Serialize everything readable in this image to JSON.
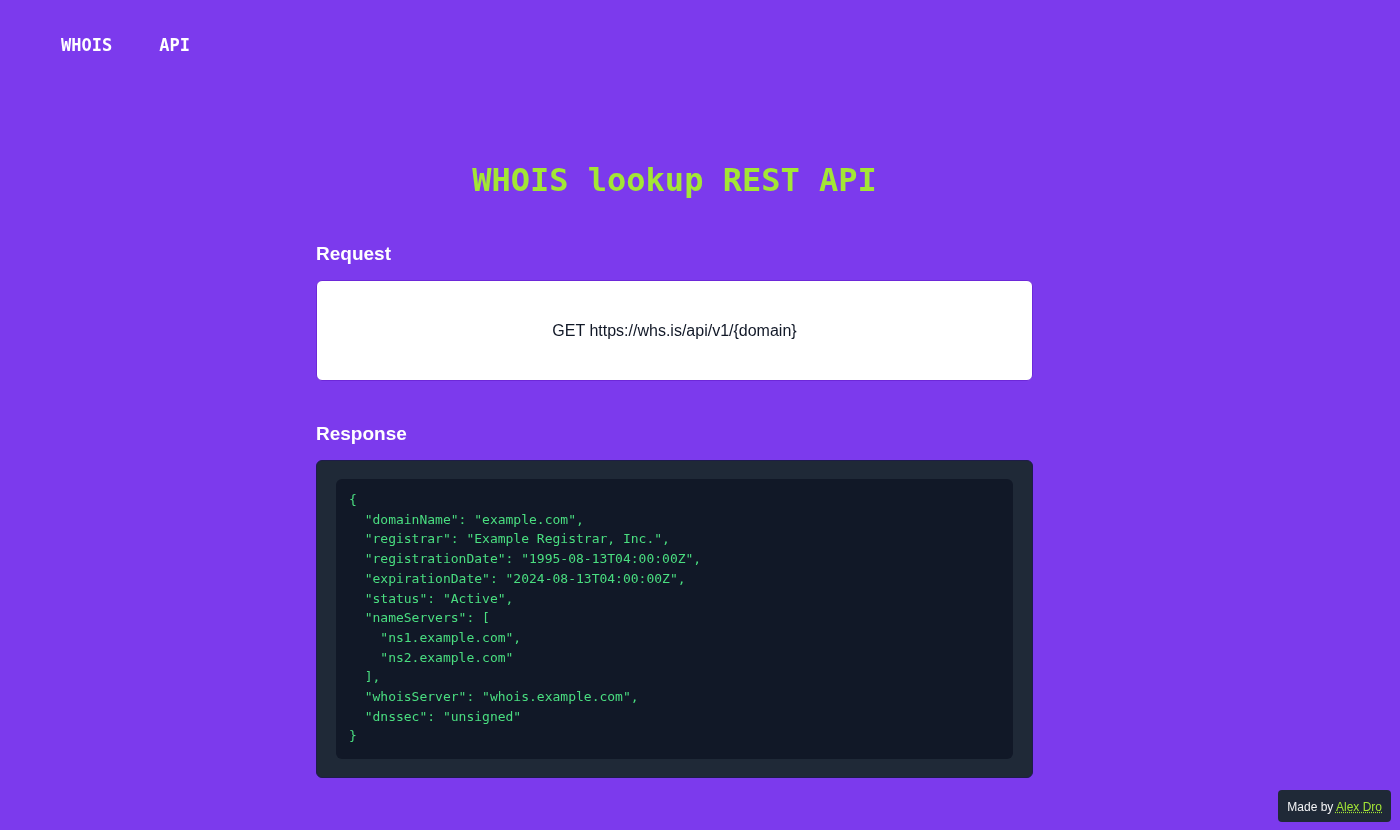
{
  "nav": {
    "items": [
      "WHOIS",
      "API"
    ]
  },
  "title": "WHOIS lookup REST API",
  "request": {
    "heading": "Request",
    "endpoint": "GET https://whs.is/api/v1/{domain}"
  },
  "response": {
    "heading": "Response",
    "code": "{\n  \"domainName\": \"example.com\",\n  \"registrar\": \"Example Registrar, Inc.\",\n  \"registrationDate\": \"1995-08-13T04:00:00Z\",\n  \"expirationDate\": \"2024-08-13T04:00:00Z\",\n  \"status\": \"Active\",\n  \"nameServers\": [\n    \"ns1.example.com\",\n    \"ns2.example.com\"\n  ],\n  \"whoisServer\": \"whois.example.com\",\n  \"dnssec\": \"unsigned\"\n}"
  },
  "footer": {
    "text": "Made by",
    "link": "Alex Dro"
  }
}
